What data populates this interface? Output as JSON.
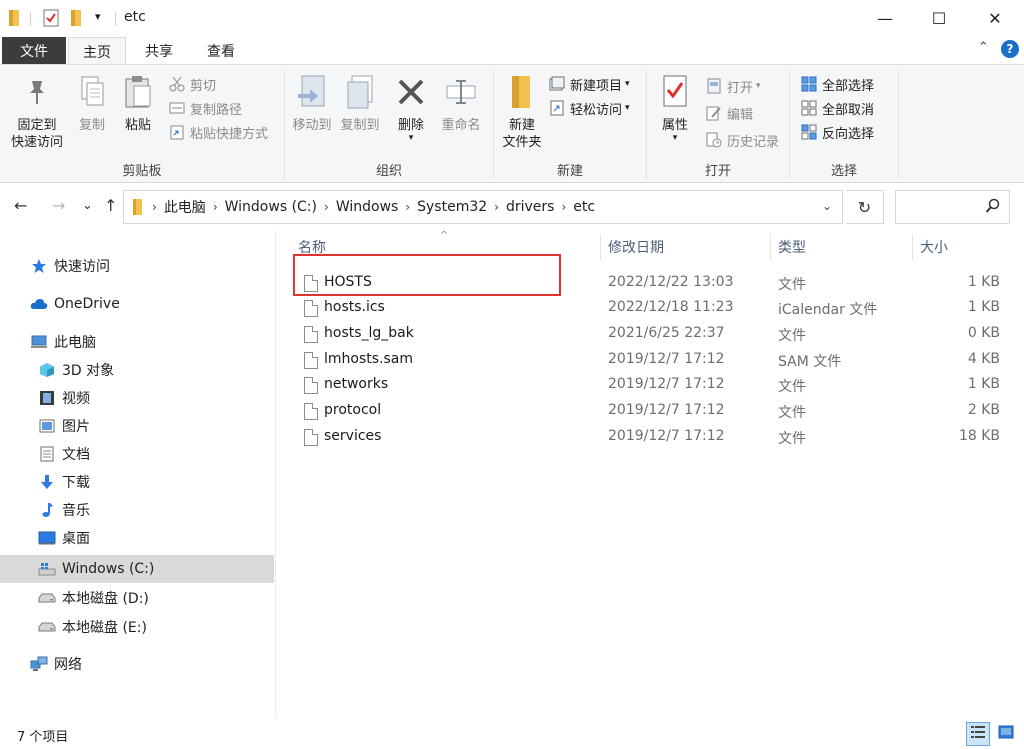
{
  "window": {
    "title": "etc",
    "minimize_glyph": "—",
    "maximize_glyph": "☐",
    "close_glyph": "✕"
  },
  "quick_access_toolbar": {
    "dropdown_glyph": "▾"
  },
  "tabs": {
    "file": "文件",
    "home": "主页",
    "share": "共享",
    "view": "查看",
    "collapse_glyph": "⌃",
    "help_glyph": "?"
  },
  "ribbon": {
    "clipboard": {
      "label": "剪贴板",
      "pin_line1": "固定到",
      "pin_line2": "快速访问",
      "copy": "复制",
      "paste": "粘贴",
      "cut": "剪切",
      "copy_path": "复制路径",
      "paste_shortcut": "粘贴快捷方式"
    },
    "organize": {
      "label": "组织",
      "move_to": "移动到",
      "copy_to": "复制到",
      "delete": "删除",
      "rename": "重命名"
    },
    "new": {
      "label": "新建",
      "new_folder_line1": "新建",
      "new_folder_line2": "文件夹",
      "new_item": "新建项目",
      "easy_access": "轻松访问"
    },
    "open": {
      "label": "打开",
      "properties": "属性",
      "open": "打开",
      "edit": "编辑",
      "history": "历史记录"
    },
    "select": {
      "label": "选择",
      "select_all": "全部选择",
      "select_none": "全部取消",
      "invert": "反向选择"
    }
  },
  "address": {
    "breadcrumbs": [
      "此电脑",
      "Windows (C:)",
      "Windows",
      "System32",
      "drivers",
      "etc"
    ],
    "separator": "›",
    "dropdown_glyph": "⌄",
    "refresh_glyph": "↻",
    "back_glyph": "←",
    "forward_glyph": "→",
    "recent_glyph": "⌄",
    "up_glyph": "↑"
  },
  "search": {
    "placeholder": ""
  },
  "nav_pane": {
    "quick_access": "快速访问",
    "onedrive": "OneDrive",
    "this_pc": "此电脑",
    "objects3d": "3D 对象",
    "videos": "视频",
    "pictures": "图片",
    "documents": "文档",
    "downloads": "下载",
    "music": "音乐",
    "desktop": "桌面",
    "drive_c": "Windows (C:)",
    "drive_d": "本地磁盘 (D:)",
    "drive_e": "本地磁盘 (E:)",
    "network": "网络"
  },
  "columns": {
    "name": "名称",
    "date": "修改日期",
    "type": "类型",
    "size": "大小",
    "sort_glyph": "^"
  },
  "files": [
    {
      "name": "HOSTS",
      "date": "2022/12/22 13:03",
      "type": "文件",
      "size": "1 KB"
    },
    {
      "name": "hosts.ics",
      "date": "2022/12/18 11:23",
      "type": "iCalendar 文件",
      "size": "1 KB"
    },
    {
      "name": "hosts_lg_bak",
      "date": "2021/6/25 22:37",
      "type": "文件",
      "size": "0 KB"
    },
    {
      "name": "lmhosts.sam",
      "date": "2019/12/7 17:12",
      "type": "SAM 文件",
      "size": "4 KB"
    },
    {
      "name": "networks",
      "date": "2019/12/7 17:12",
      "type": "文件",
      "size": "1 KB"
    },
    {
      "name": "protocol",
      "date": "2019/12/7 17:12",
      "type": "文件",
      "size": "2 KB"
    },
    {
      "name": "services",
      "date": "2019/12/7 17:12",
      "type": "文件",
      "size": "18 KB"
    }
  ],
  "status": {
    "item_count": "7 个项目"
  },
  "colors": {
    "accent": "#1c6fc9",
    "highlight_box": "#e0332e",
    "selected_nav": "#d9d9d9",
    "folder_yellow": "#f2c14e"
  }
}
